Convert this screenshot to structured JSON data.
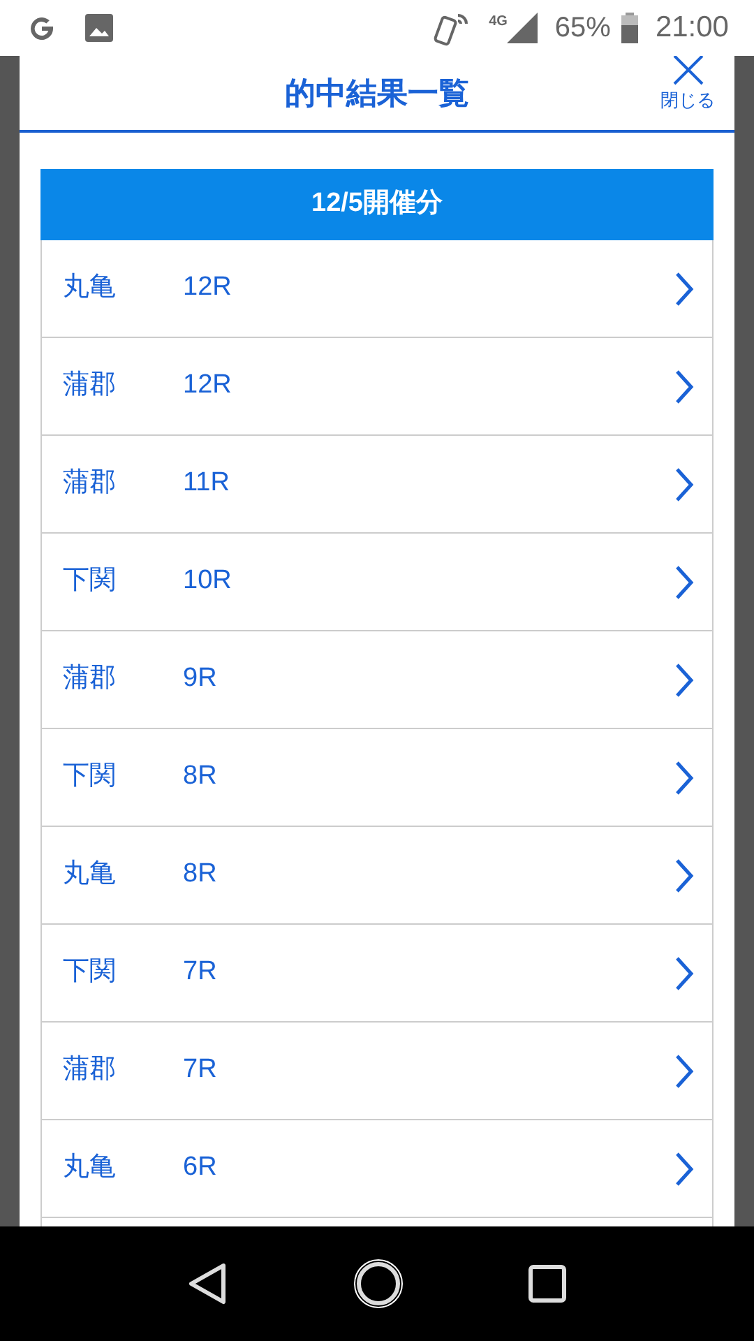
{
  "status_bar": {
    "battery": "65%",
    "network": "4G",
    "time": "21:00"
  },
  "modal": {
    "title": "的中結果一覧",
    "close_label": "閉じる"
  },
  "section": {
    "title": "12/5開催分"
  },
  "rows": [
    {
      "venue": "丸亀",
      "race": "12R"
    },
    {
      "venue": "蒲郡",
      "race": "12R"
    },
    {
      "venue": "蒲郡",
      "race": "11R"
    },
    {
      "venue": "下関",
      "race": "10R"
    },
    {
      "venue": "蒲郡",
      "race": "9R"
    },
    {
      "venue": "下関",
      "race": "8R"
    },
    {
      "venue": "丸亀",
      "race": "8R"
    },
    {
      "venue": "下関",
      "race": "7R"
    },
    {
      "venue": "蒲郡",
      "race": "7R"
    },
    {
      "venue": "丸亀",
      "race": "6R"
    }
  ]
}
